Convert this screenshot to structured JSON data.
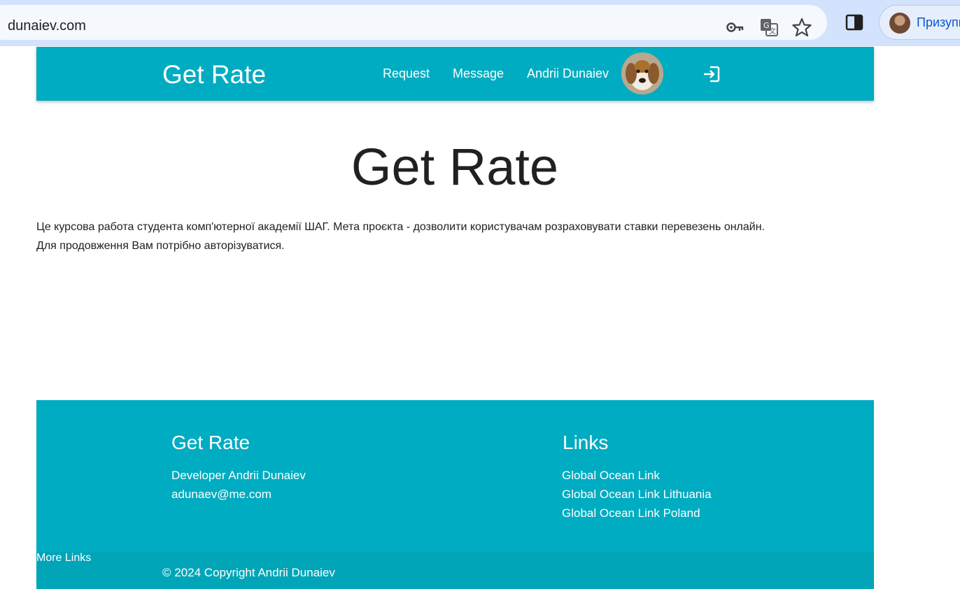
{
  "browser": {
    "url": "dunaiev.com",
    "icons": [
      "site-info-icon",
      "key-icon",
      "translate-icon",
      "star-icon",
      "side-panel-icon"
    ],
    "profile_name": "Призупи"
  },
  "navbar": {
    "brand": "Get Rate",
    "links": [
      "Request",
      "Message",
      "Andrii Dunaiev"
    ],
    "icons": [
      "avatar",
      "logout-icon"
    ]
  },
  "main": {
    "title": "Get Rate",
    "intro_line1": "Це курсова работа студента комп'ютерної академії ШАГ. Мета проєкта - дозволити користувачам розраховувати ставки перевезень онлайн.",
    "intro_line2": "Для продовження Вам потрібно авторізуватися."
  },
  "footer": {
    "col1": {
      "title": "Get Rate",
      "lines": [
        "Developer Andrii Dunaiev",
        "adunaev@me.com"
      ]
    },
    "col2": {
      "title": "Links",
      "links": [
        "Global Ocean Link",
        "Global Ocean Link Lithuania",
        "Global Ocean Link Poland"
      ]
    },
    "copyright": "© 2024 Copyright Andrii Dunaiev",
    "more_links": "More Links"
  },
  "colors": {
    "primary": "#00acc1",
    "chrome_bg": "#d3e3fd",
    "text_dark": "#212121"
  }
}
